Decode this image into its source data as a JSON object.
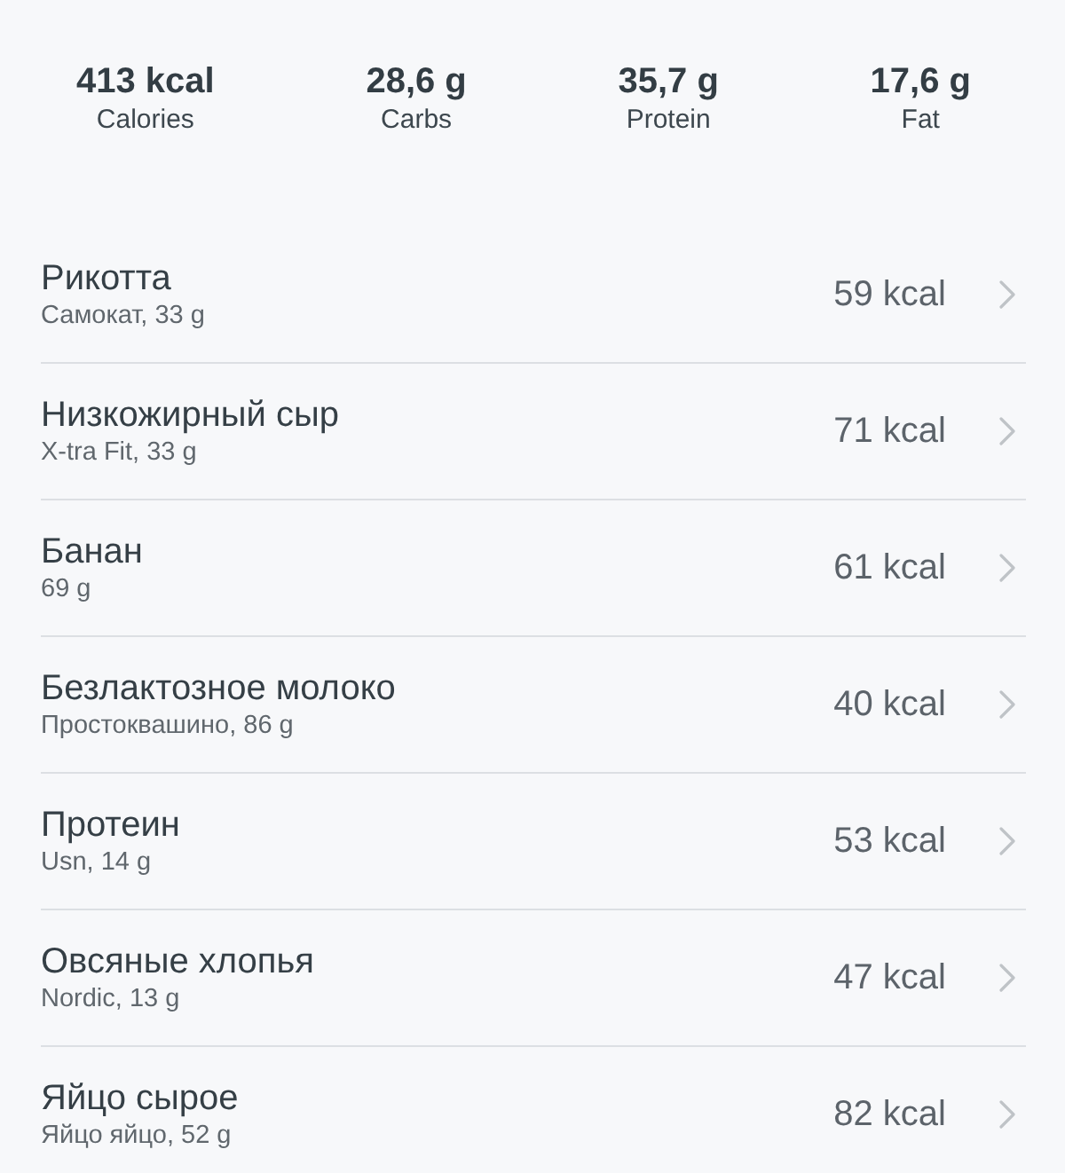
{
  "summary": [
    {
      "value": "413 kcal",
      "label": "Calories"
    },
    {
      "value": "28,6 g",
      "label": "Carbs"
    },
    {
      "value": "35,7 g",
      "label": "Protein"
    },
    {
      "value": "17,6 g",
      "label": "Fat"
    }
  ],
  "foods": [
    {
      "name": "Рикотта",
      "detail": "Самокат, 33 g",
      "kcal": "59 kcal"
    },
    {
      "name": "Низкожирный сыр",
      "detail": "X-tra Fit, 33 g",
      "kcal": "71 kcal"
    },
    {
      "name": "Банан",
      "detail": "69 g",
      "kcal": "61 kcal"
    },
    {
      "name": "Безлактозное молоко",
      "detail": "Простоквашино, 86 g",
      "kcal": "40 kcal"
    },
    {
      "name": "Протеин",
      "detail": "Usn, 14 g",
      "kcal": "53 kcal"
    },
    {
      "name": "Овсяные хлопья",
      "detail": "Nordic, 13 g",
      "kcal": "47 kcal"
    },
    {
      "name": "Яйцо сырое",
      "detail": "Яйцо яйцо, 52 g",
      "kcal": "82 kcal"
    }
  ]
}
